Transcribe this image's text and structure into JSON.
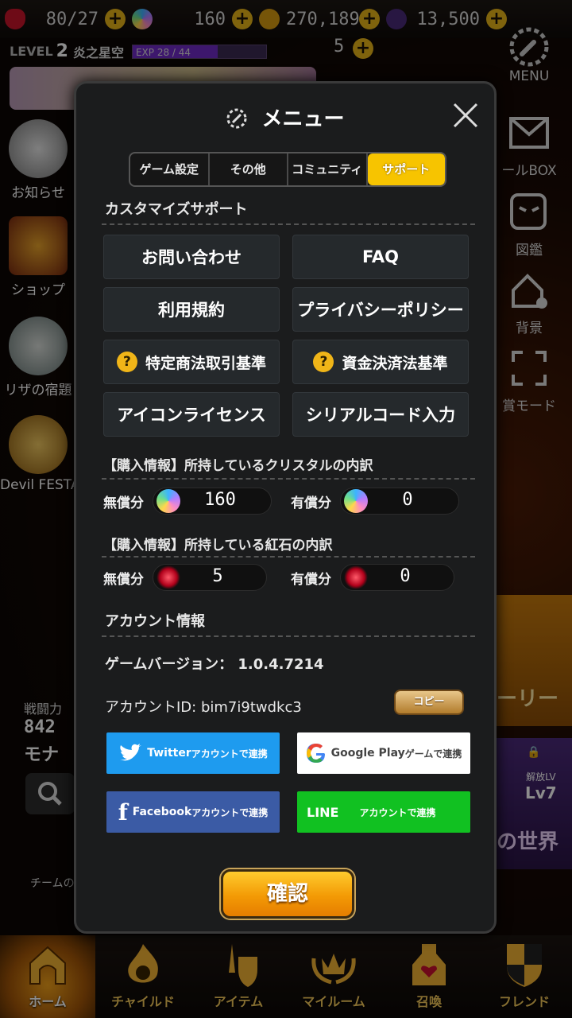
{
  "topbar": {
    "hearts": "80/27",
    "crystals": "160",
    "gold": "270,189",
    "dark": "13,500"
  },
  "player": {
    "level_label": "LEVEL",
    "level": "2",
    "name": "炎之星空",
    "exp": "EXP 28 / 44",
    "exp_fraction": 0.636,
    "red_stone": "5"
  },
  "left_menu": [
    {
      "label": "お知らせ"
    },
    {
      "label": "ショップ"
    },
    {
      "label": "リザの宿題"
    },
    {
      "label": "Devil FESTA"
    }
  ],
  "right_menu": [
    {
      "label": "MENU"
    },
    {
      "label": "ールBOX"
    },
    {
      "label": "図鑑"
    },
    {
      "label": "背景"
    },
    {
      "label": "賞モード"
    }
  ],
  "events": {
    "story_label": "ーリー",
    "world_label": "の世界",
    "unlock_label": "解放LV",
    "unlock_level": "Lv7"
  },
  "power": {
    "label": "戦闘力",
    "value": "842",
    "name": "モナ"
  },
  "team_label": "チームの",
  "bottom_nav": [
    {
      "label": "ホーム"
    },
    {
      "label": "チャイルド"
    },
    {
      "label": "アイテム"
    },
    {
      "label": "マイルーム"
    },
    {
      "label": "召喚"
    },
    {
      "label": "フレンド"
    }
  ],
  "modal": {
    "title": "メニュー",
    "tabs": [
      "ゲーム設定",
      "その他",
      "コミュニティ",
      "サポート"
    ],
    "selected_tab": 3,
    "customize_header": "カスタマイズサポート",
    "buttons": {
      "contact": "お問い合わせ",
      "faq": "FAQ",
      "terms": "利用規約",
      "privacy": "プライバシーポリシー",
      "commerce": "特定商法取引基準",
      "payment": "資金決済法基準",
      "icon_license": "アイコンライセンス",
      "serial": "シリアルコード入力"
    },
    "crystal_header": "【購入情報】所持しているクリスタルの内訳",
    "red_header": "【購入情報】所持している紅石の内訳",
    "free_label": "無償分",
    "paid_label": "有償分",
    "crystal_free": "160",
    "crystal_paid": "0",
    "red_free": "5",
    "red_paid": "0",
    "account_header": "アカウント情報",
    "version_line": "ゲームバージョン： 1.0.4.7214",
    "account_line": "アカウントID: bim7i9twdkc3",
    "copy_label": "コピー",
    "sns": {
      "twitter_brand": "Twitter",
      "twitter_suffix": "アカウントで連携",
      "google_brand": "Google Play",
      "google_suffix": "ゲームで連携",
      "facebook_brand": "Facebook",
      "facebook_suffix": "アカウントで連携",
      "line_brand": "LINE",
      "line_suffix": "アカウントで連携"
    },
    "ok_label": "確認"
  }
}
